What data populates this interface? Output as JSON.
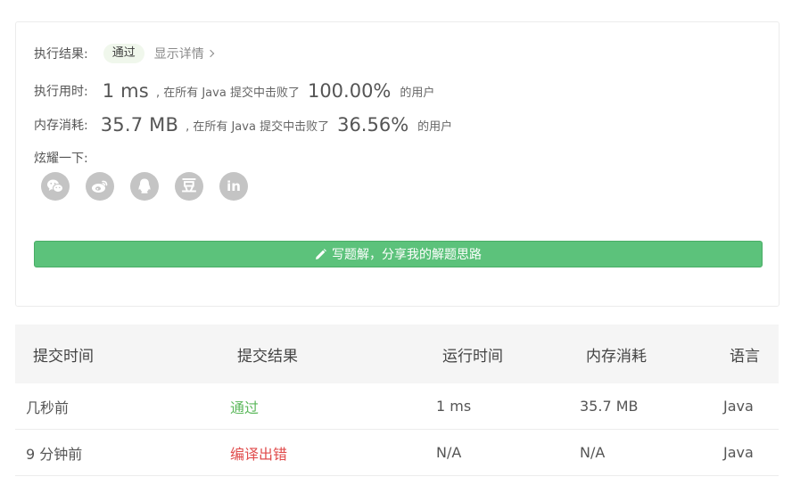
{
  "result": {
    "status_label": "执行结果:",
    "status_badge": "通过",
    "details_link": "显示详情",
    "runtime_label": "执行用时:",
    "runtime_value": "1 ms",
    "runtime_mid": ", 在所有 Java 提交中击败了",
    "runtime_pct": "100.00%",
    "runtime_suffix": "的用户",
    "memory_label": "内存消耗:",
    "memory_value": "35.7 MB",
    "memory_mid": ", 在所有 Java 提交中击败了",
    "memory_pct": "36.56%",
    "memory_suffix": "的用户",
    "share_label": "炫耀一下:",
    "share_icons": [
      "wechat-icon",
      "weibo-icon",
      "qq-icon",
      "douban-icon",
      "linkedin-icon"
    ],
    "share_douban_glyph": "豆",
    "share_linkedin_glyph": "in",
    "write_solution_label": "写题解，分享我的解题思路"
  },
  "submissions": {
    "headers": [
      "提交时间",
      "提交结果",
      "运行时间",
      "内存消耗",
      "语言"
    ],
    "rows": [
      {
        "time": "几秒前",
        "result": "通过",
        "runtime": "1 ms",
        "memory": "35.7 MB",
        "lang": "Java"
      },
      {
        "time": "9 分钟前",
        "result": "编译出错",
        "runtime": "N/A",
        "memory": "N/A",
        "lang": "Java"
      }
    ]
  },
  "colors": {
    "accepted": "#5cb85c",
    "error": "#e04c4c",
    "button": "#5cc27b",
    "icon_bg": "#c4c4c4"
  }
}
